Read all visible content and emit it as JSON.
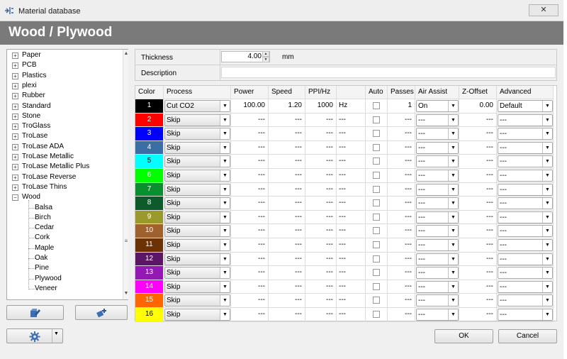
{
  "window": {
    "title": "Material database",
    "close_glyph": "✕"
  },
  "header": {
    "title": "Wood / Plywood"
  },
  "tree": {
    "items": [
      {
        "label": "Paper",
        "expander": "+"
      },
      {
        "label": "PCB",
        "expander": "+"
      },
      {
        "label": "Plastics",
        "expander": "+"
      },
      {
        "label": "plexi",
        "expander": "+"
      },
      {
        "label": "Rubber",
        "expander": "+"
      },
      {
        "label": "Standard",
        "expander": "+"
      },
      {
        "label": "Stone",
        "expander": "+"
      },
      {
        "label": "TroGlass",
        "expander": "+"
      },
      {
        "label": "TroLase",
        "expander": "+"
      },
      {
        "label": "TroLase ADA",
        "expander": "+"
      },
      {
        "label": "TroLase Metallic",
        "expander": "+"
      },
      {
        "label": "TroLase Metallic Plus",
        "expander": "+"
      },
      {
        "label": "TroLase Reverse",
        "expander": "+"
      },
      {
        "label": "TroLase Thins",
        "expander": "+"
      },
      {
        "label": "Wood",
        "expander": "−"
      }
    ],
    "children": [
      "Balsa",
      "Birch",
      "Cedar",
      "Cork",
      "Maple",
      "Oak",
      "Pine",
      "Plywood",
      "Veneer"
    ],
    "selected": "Plywood"
  },
  "props": {
    "thickness_label": "Thickness",
    "thickness_value": "4.00",
    "thickness_unit": "mm",
    "description_label": "Description",
    "description_value": ""
  },
  "grid": {
    "headers": [
      "Color",
      "Process",
      "Power",
      "Speed",
      "PPI/Hz",
      "",
      "Auto",
      "Passes",
      "Air Assist",
      "Z-Offset",
      "Advanced"
    ],
    "rows": [
      {
        "n": "1",
        "color": "#000000",
        "text_color": "#ffffff",
        "process": "Cut CO2",
        "power": "100.00",
        "speed": "1.20",
        "ppi": "1000",
        "unit": "Hz",
        "passes": "1",
        "air": "On",
        "z": "0.00",
        "adv": "Default"
      },
      {
        "n": "2",
        "color": "#ff0000",
        "text_color": "#ffffff",
        "process": "Skip",
        "power": "---",
        "speed": "---",
        "ppi": "---",
        "unit": "---",
        "passes": "---",
        "air": "---",
        "z": "---",
        "adv": "---"
      },
      {
        "n": "3",
        "color": "#0000ff",
        "text_color": "#ffffff",
        "process": "Skip",
        "power": "---",
        "speed": "---",
        "ppi": "---",
        "unit": "---",
        "passes": "---",
        "air": "---",
        "z": "---",
        "adv": "---"
      },
      {
        "n": "4",
        "color": "#3a6ea5",
        "text_color": "#ffffff",
        "process": "Skip",
        "power": "---",
        "speed": "---",
        "ppi": "---",
        "unit": "---",
        "passes": "---",
        "air": "---",
        "z": "---",
        "adv": "---"
      },
      {
        "n": "5",
        "color": "#00ffff",
        "text_color": "#000000",
        "process": "Skip",
        "power": "---",
        "speed": "---",
        "ppi": "---",
        "unit": "---",
        "passes": "---",
        "air": "---",
        "z": "---",
        "adv": "---"
      },
      {
        "n": "6",
        "color": "#00ff00",
        "text_color": "#ffffff",
        "process": "Skip",
        "power": "---",
        "speed": "---",
        "ppi": "---",
        "unit": "---",
        "passes": "---",
        "air": "---",
        "z": "---",
        "adv": "---"
      },
      {
        "n": "7",
        "color": "#0a8f2e",
        "text_color": "#ffffff",
        "process": "Skip",
        "power": "---",
        "speed": "---",
        "ppi": "---",
        "unit": "---",
        "passes": "---",
        "air": "---",
        "z": "---",
        "adv": "---"
      },
      {
        "n": "8",
        "color": "#0d5b2a",
        "text_color": "#ffffff",
        "process": "Skip",
        "power": "---",
        "speed": "---",
        "ppi": "---",
        "unit": "---",
        "passes": "---",
        "air": "---",
        "z": "---",
        "adv": "---"
      },
      {
        "n": "9",
        "color": "#9a9a2a",
        "text_color": "#ffffff",
        "process": "Skip",
        "power": "---",
        "speed": "---",
        "ppi": "---",
        "unit": "---",
        "passes": "---",
        "air": "---",
        "z": "---",
        "adv": "---"
      },
      {
        "n": "10",
        "color": "#a0612d",
        "text_color": "#ffffff",
        "process": "Skip",
        "power": "---",
        "speed": "---",
        "ppi": "---",
        "unit": "---",
        "passes": "---",
        "air": "---",
        "z": "---",
        "adv": "---"
      },
      {
        "n": "11",
        "color": "#6b3206",
        "text_color": "#ffffff",
        "process": "Skip",
        "power": "---",
        "speed": "---",
        "ppi": "---",
        "unit": "---",
        "passes": "---",
        "air": "---",
        "z": "---",
        "adv": "---"
      },
      {
        "n": "12",
        "color": "#5c1666",
        "text_color": "#ffffff",
        "process": "Skip",
        "power": "---",
        "speed": "---",
        "ppi": "---",
        "unit": "---",
        "passes": "---",
        "air": "---",
        "z": "---",
        "adv": "---"
      },
      {
        "n": "13",
        "color": "#9517b5",
        "text_color": "#ffffff",
        "process": "Skip",
        "power": "---",
        "speed": "---",
        "ppi": "---",
        "unit": "---",
        "passes": "---",
        "air": "---",
        "z": "---",
        "adv": "---"
      },
      {
        "n": "14",
        "color": "#ff00ff",
        "text_color": "#ffffff",
        "process": "Skip",
        "power": "---",
        "speed": "---",
        "ppi": "---",
        "unit": "---",
        "passes": "---",
        "air": "---",
        "z": "---",
        "adv": "---"
      },
      {
        "n": "15",
        "color": "#ff6600",
        "text_color": "#ffffff",
        "process": "Skip",
        "power": "---",
        "speed": "---",
        "ppi": "---",
        "unit": "---",
        "passes": "---",
        "air": "---",
        "z": "---",
        "adv": "---"
      },
      {
        "n": "16",
        "color": "#ffff00",
        "text_color": "#000000",
        "process": "Skip",
        "power": "---",
        "speed": "---",
        "ppi": "---",
        "unit": "---",
        "passes": "---",
        "air": "---",
        "z": "---",
        "adv": "---"
      }
    ]
  },
  "buttons": {
    "ok": "OK",
    "cancel": "Cancel",
    "dropdown_glyph": "▼"
  },
  "icons": {
    "app": "laser-app-icon",
    "edit_material": "edit-material-icon",
    "add_material": "add-material-icon",
    "settings": "gear-icon",
    "dropdown": "chevron-down-icon"
  }
}
